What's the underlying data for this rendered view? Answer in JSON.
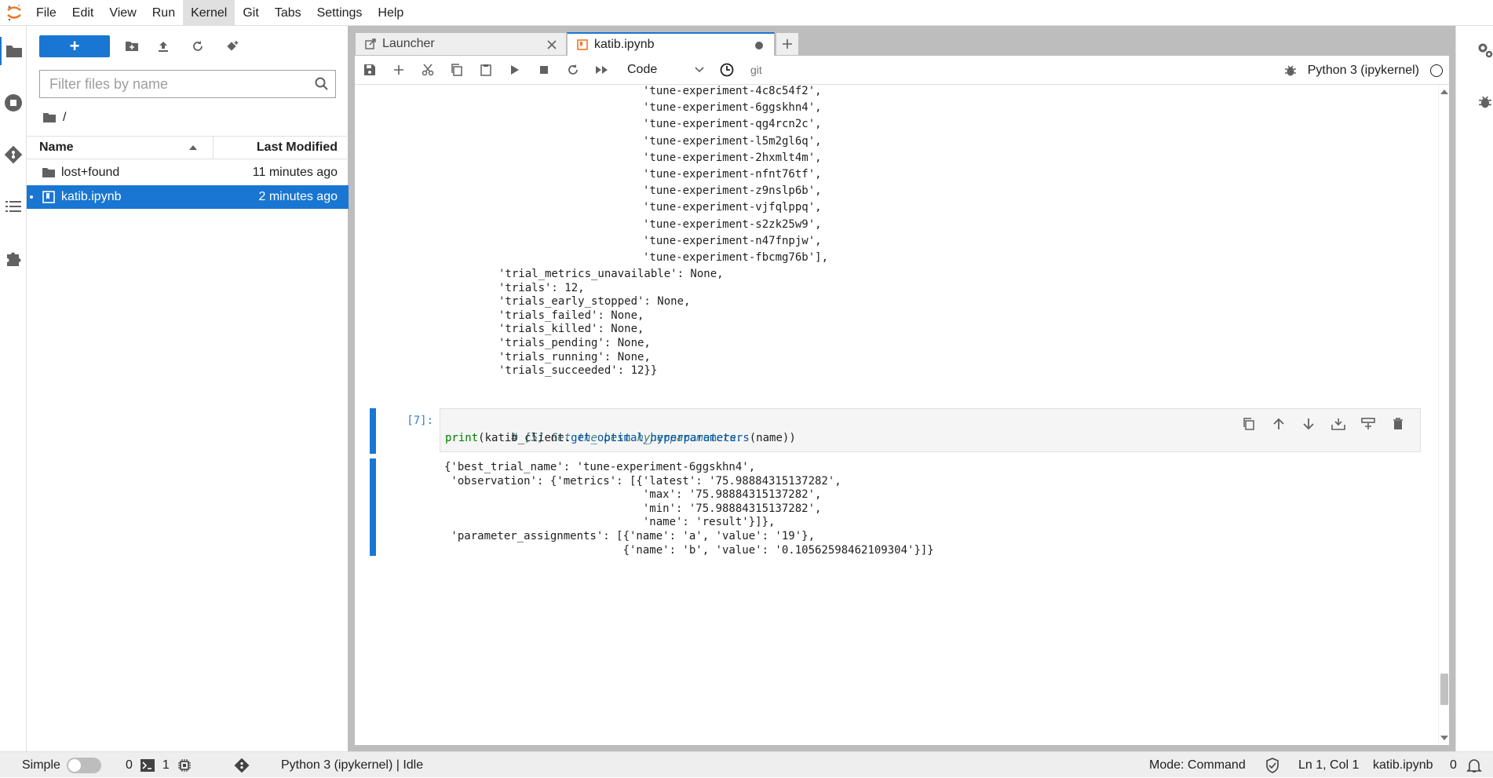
{
  "menubar": {
    "items": [
      "File",
      "Edit",
      "View",
      "Run",
      "Kernel",
      "Git",
      "Tabs",
      "Settings",
      "Help"
    ],
    "active": "Kernel"
  },
  "filebrowser": {
    "new_label": "+",
    "filter_placeholder": "Filter files by name",
    "breadcrumb": "/",
    "col_name": "Name",
    "col_modified": "Last Modified",
    "rows": [
      {
        "name": "lost+found",
        "modified": "11 minutes ago",
        "kind": "folder"
      },
      {
        "name": "katib.ipynb",
        "modified": "2 minutes ago",
        "kind": "notebook"
      }
    ]
  },
  "tabs": [
    {
      "label": "Launcher"
    },
    {
      "label": "katib.ipynb"
    }
  ],
  "toolbar": {
    "cell_type": "Code",
    "git_label": "git",
    "kernel_name": "Python 3 (ipykernel)"
  },
  "output_prev": [
    "'tune-experiment-4c8c54f2',",
    "'tune-experiment-6ggskhn4',",
    "'tune-experiment-qg4rcn2c',",
    "'tune-experiment-l5m2gl6q',",
    "'tune-experiment-2hxmlt4m',",
    "'tune-experiment-nfnt76tf',",
    "'tune-experiment-z9nslp6b',",
    "'tune-experiment-vjfqlppq',",
    "'tune-experiment-s2zk25w9',",
    "'tune-experiment-n47fnpjw',",
    "'tune-experiment-fbcmg76b'],"
  ],
  "output_prev_2": [
    "'trial_metrics_unavailable': None,",
    "'trials': 12,",
    "'trials_early_stopped': None,",
    "'trials_failed': None,",
    "'trials_killed': None,",
    "'trials_pending': None,",
    "'trials_running': None,",
    "'trials_succeeded': 12}}"
  ],
  "cell7": {
    "prompt": "[7]:",
    "line1": "# [5] Get the best hyperparameters.",
    "line2_builtin": "print",
    "line2_pre": "(katib_client.",
    "line2_attr": "get_optimal_hyperparameters",
    "line2_post": "(name))"
  },
  "output7": [
    "{'best_trial_name': 'tune-experiment-6ggskhn4',",
    " 'observation': {'metrics': [{'latest': '75.98884315137282',",
    "                              'max': '75.98884315137282',",
    "                              'min': '75.98884315137282',",
    "                              'name': 'result'}]},",
    " 'parameter_assignments': [{'name': 'a', 'value': '19'},",
    "                           {'name': 'b', 'value': '0.10562598462109304'}]}"
  ],
  "statusbar": {
    "mode_label": "Simple",
    "terminals": "0",
    "kernels": "1",
    "kernel_status": "Python 3 (ipykernel) | Idle",
    "mode": "Mode: Command",
    "position": "Ln 1, Col 1",
    "filename": "katib.ipynb",
    "notifications": "0"
  },
  "colors": {
    "accent": "#1976d2"
  }
}
